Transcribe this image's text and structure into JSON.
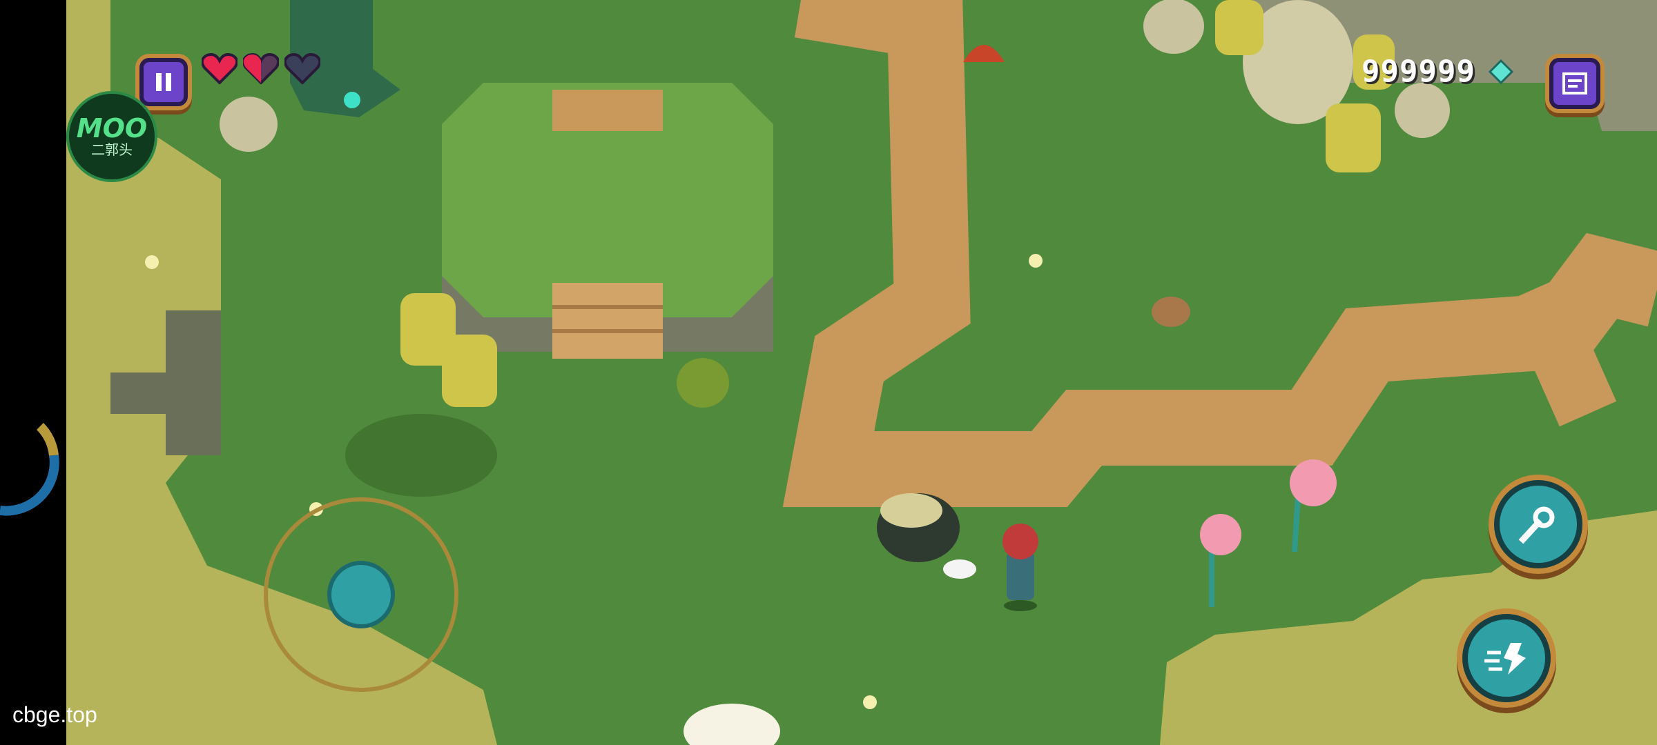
{
  "hud": {
    "coins": "999999",
    "hearts": [
      {
        "state": "full"
      },
      {
        "state": "half"
      },
      {
        "state": "empty"
      }
    ]
  },
  "overlay": {
    "badge_title": "MOO",
    "badge_subtitle": "二郭头",
    "watermark": "cbge.top"
  },
  "icons": {
    "pause": "pause-icon",
    "journal": "journal-icon",
    "gem": "gem-icon",
    "attack": "sword-icon",
    "dash": "dash-icon"
  },
  "colors": {
    "grass": "#4f8a3d",
    "grass_light": "#b9b858",
    "path": "#c8995a",
    "button_purple": "#6c44c9",
    "button_teal": "#2fa0a4",
    "button_rim": "#c48a3c",
    "heart": "#e8264f",
    "gem": "#5fe3d2"
  }
}
